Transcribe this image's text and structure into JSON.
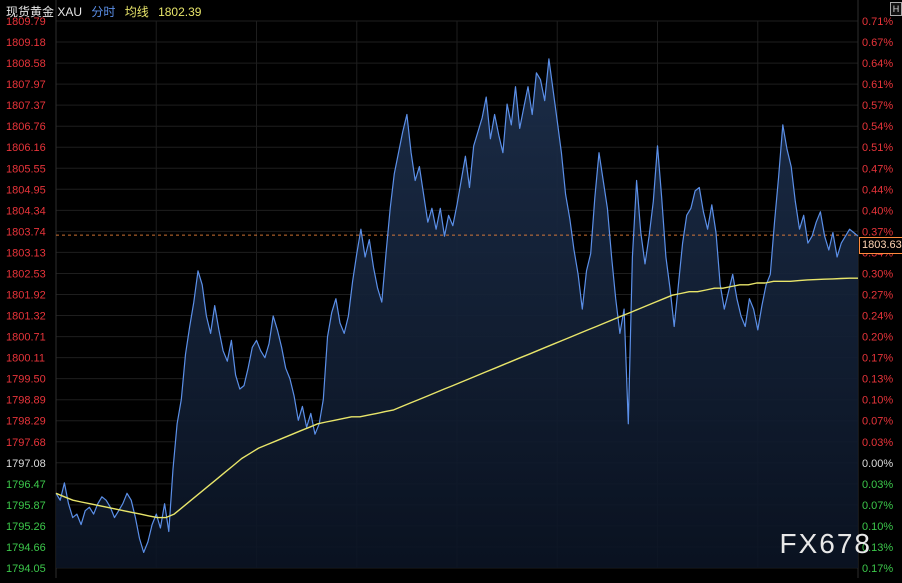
{
  "header": {
    "instrument": "现货黄金 XAU",
    "mode": "分时",
    "avg_label": "均线",
    "avg_value": "1802.39"
  },
  "corner_button": "H",
  "price_tag": "1803.63",
  "watermark": "FX678",
  "colors": {
    "background": "#000000",
    "price_line": "#5b8fe8",
    "avg_line": "#e8e56a",
    "up": "#e8343a",
    "down": "#3cc84b",
    "neutral": "#dddddd",
    "ref_line": "#ff8b3d"
  },
  "chart_data": {
    "type": "line",
    "y_ticks_left": [
      "1809.79",
      "1809.18",
      "1808.58",
      "1807.97",
      "1807.37",
      "1806.76",
      "1806.16",
      "1805.55",
      "1804.95",
      "1804.34",
      "1803.74",
      "1803.13",
      "1802.53",
      "1801.92",
      "1801.32",
      "1800.71",
      "1800.11",
      "1799.50",
      "1798.89",
      "1798.29",
      "1797.68",
      "1797.08",
      "1796.47",
      "1795.87",
      "1795.26",
      "1794.66",
      "1794.05"
    ],
    "y_ticks_right": [
      "0.71%",
      "0.67%",
      "0.64%",
      "0.61%",
      "0.57%",
      "0.54%",
      "0.51%",
      "0.47%",
      "0.44%",
      "0.40%",
      "0.37%",
      "0.34%",
      "0.30%",
      "0.27%",
      "0.24%",
      "0.20%",
      "0.17%",
      "0.13%",
      "0.10%",
      "0.07%",
      "0.03%",
      "0.00%",
      "0.03%",
      "0.07%",
      "0.10%",
      "0.13%",
      "0.17%"
    ],
    "ylim": [
      1794.05,
      1809.79
    ],
    "prev_close": 1797.08,
    "ref_price": 1803.63,
    "grid": true,
    "series": [
      {
        "name": "分时",
        "values": [
          1796.2,
          1796.0,
          1796.5,
          1795.9,
          1795.5,
          1795.6,
          1795.3,
          1795.7,
          1795.8,
          1795.6,
          1795.9,
          1796.1,
          1796.0,
          1795.8,
          1795.5,
          1795.7,
          1795.9,
          1796.2,
          1796.0,
          1795.5,
          1794.9,
          1794.5,
          1794.8,
          1795.3,
          1795.6,
          1795.2,
          1795.9,
          1795.1,
          1796.9,
          1798.2,
          1798.9,
          1800.2,
          1801.0,
          1801.7,
          1802.6,
          1802.2,
          1801.3,
          1800.8,
          1801.6,
          1800.9,
          1800.3,
          1800.0,
          1800.6,
          1799.6,
          1799.2,
          1799.3,
          1799.8,
          1800.4,
          1800.6,
          1800.3,
          1800.1,
          1800.5,
          1801.3,
          1800.9,
          1800.4,
          1799.8,
          1799.5,
          1799.0,
          1798.3,
          1798.7,
          1798.1,
          1798.5,
          1797.9,
          1798.2,
          1798.9,
          1800.7,
          1801.4,
          1801.8,
          1801.1,
          1800.8,
          1801.3,
          1802.3,
          1803.1,
          1803.8,
          1803.0,
          1803.5,
          1802.7,
          1802.1,
          1801.7,
          1803.1,
          1804.4,
          1805.4,
          1806.0,
          1806.6,
          1807.1,
          1806.0,
          1805.2,
          1805.6,
          1804.8,
          1804.0,
          1804.4,
          1803.8,
          1804.4,
          1803.6,
          1804.2,
          1803.9,
          1804.5,
          1805.2,
          1805.9,
          1805.0,
          1806.2,
          1806.6,
          1807.0,
          1807.6,
          1806.4,
          1807.1,
          1806.5,
          1806.0,
          1807.4,
          1806.8,
          1807.9,
          1806.7,
          1807.3,
          1807.9,
          1807.1,
          1808.3,
          1808.1,
          1807.5,
          1808.7,
          1807.8,
          1806.9,
          1806.0,
          1804.8,
          1804.1,
          1803.2,
          1802.5,
          1801.5,
          1802.6,
          1803.1,
          1804.7,
          1806.0,
          1805.2,
          1804.4,
          1803.0,
          1801.8,
          1800.8,
          1801.5,
          1798.2,
          1803.0,
          1805.2,
          1803.7,
          1802.8,
          1803.6,
          1804.6,
          1806.2,
          1804.7,
          1803.0,
          1802.1,
          1801.0,
          1802.2,
          1803.4,
          1804.2,
          1804.4,
          1804.9,
          1805.0,
          1804.3,
          1803.8,
          1804.5,
          1803.7,
          1802.2,
          1801.5,
          1802.0,
          1802.5,
          1801.8,
          1801.3,
          1801.0,
          1801.8,
          1801.5,
          1800.9,
          1801.6,
          1802.2,
          1802.5,
          1804.0,
          1805.3,
          1806.8,
          1806.1,
          1805.6,
          1804.6,
          1803.8,
          1804.2,
          1803.4,
          1803.6,
          1804.0,
          1804.3,
          1803.6,
          1803.2,
          1803.7,
          1803.0,
          1803.4,
          1803.6,
          1803.8,
          1803.7,
          1803.6
        ],
        "color": "#5b8fe8"
      },
      {
        "name": "均线",
        "values": [
          1796.2,
          1796.1,
          1796.0,
          1795.95,
          1795.9,
          1795.85,
          1795.8,
          1795.75,
          1795.7,
          1795.65,
          1795.6,
          1795.55,
          1795.5,
          1795.5,
          1795.6,
          1795.8,
          1796.0,
          1796.2,
          1796.4,
          1796.6,
          1796.8,
          1797.0,
          1797.2,
          1797.35,
          1797.5,
          1797.6,
          1797.7,
          1797.8,
          1797.9,
          1798.0,
          1798.1,
          1798.2,
          1798.25,
          1798.3,
          1798.35,
          1798.4,
          1798.4,
          1798.45,
          1798.5,
          1798.55,
          1798.6,
          1798.7,
          1798.8,
          1798.9,
          1799.0,
          1799.1,
          1799.2,
          1799.3,
          1799.4,
          1799.5,
          1799.6,
          1799.7,
          1799.8,
          1799.9,
          1800.0,
          1800.1,
          1800.2,
          1800.3,
          1800.4,
          1800.5,
          1800.6,
          1800.7,
          1800.8,
          1800.9,
          1801.0,
          1801.1,
          1801.2,
          1801.3,
          1801.4,
          1801.5,
          1801.6,
          1801.7,
          1801.8,
          1801.9,
          1801.95,
          1802.0,
          1802.0,
          1802.05,
          1802.1,
          1802.1,
          1802.15,
          1802.2,
          1802.2,
          1802.25,
          1802.25,
          1802.3,
          1802.3,
          1802.3,
          1802.32,
          1802.34,
          1802.35,
          1802.36,
          1802.37,
          1802.38,
          1802.39,
          1802.39
        ],
        "color": "#e8e56a"
      }
    ]
  }
}
